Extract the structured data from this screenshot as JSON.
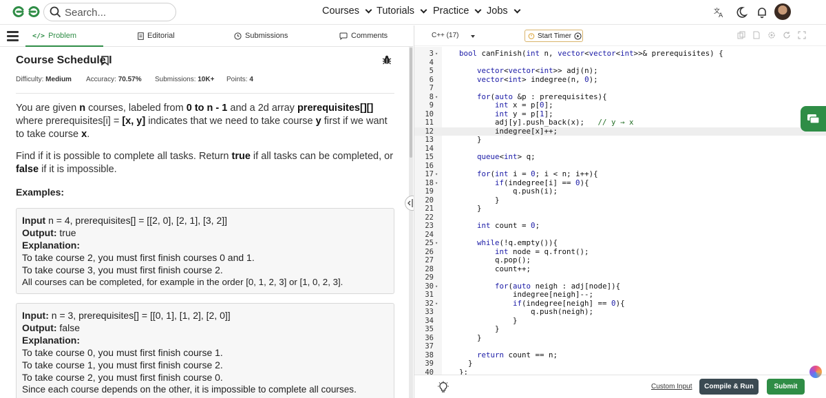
{
  "nav": {
    "search_placeholder": "Search...",
    "menus": [
      "Courses",
      "Tutorials",
      "Practice",
      "Jobs"
    ]
  },
  "tabs": {
    "problem": "Problem",
    "editorial": "Editorial",
    "submissions": "Submissions",
    "comments": "Comments"
  },
  "problem": {
    "title": "Course Schedule I",
    "difficulty_label": "Difficulty:",
    "difficulty": "Medium",
    "accuracy_label": "Accuracy:",
    "accuracy": "70.57%",
    "submissions_label": "Submissions:",
    "submissions": "10K+",
    "points_label": "Points:",
    "points": "4",
    "desc1": {
      "a": "You are given ",
      "n": "n",
      "b": " courses, labeled from ",
      "range": "0 to n - 1",
      "c": " and a 2d array ",
      "arr": "prerequisites[][]",
      "d": " where prerequisites[i] = ",
      "pair": "[x, y]",
      "e": " indicates that we need to take course ",
      "y": "y",
      "f": " first if we want to take course ",
      "x": "x",
      "g": "."
    },
    "desc2": {
      "a": "Find if it is possible to complete all tasks. Return ",
      "t": "true",
      "b": " if all tasks can be completed, or ",
      "f": "false",
      "c": " if it is impossible."
    },
    "examples_heading": "Examples:",
    "example1": {
      "input_label": "Input",
      "input": " n = 4, prerequisites[] = [[2, 0], [2, 1], [3, 2]]",
      "output_label": "Output:",
      "output": " true",
      "expl_label": "Explanation:",
      "lines": [
        "To take course 2, you must first finish courses 0 and 1.",
        "To take course 3, you must first finish course 2.",
        "All courses can be completed, for example in the order [0, 1, 2, 3] or [1, 0, 2, 3]."
      ]
    },
    "example2": {
      "input_label": "Input:",
      "input": " n = 3, prerequisites[] = [[0, 1], [1, 2], [2, 0]]",
      "output_label": "Output:",
      "output": " false",
      "expl_label": "Explanation:",
      "lines": [
        "To take course 0, you must first finish course 1.",
        "To take course 1, you must first finish course 2.",
        "To take course 2, you must first finish course 0.",
        "Since each course depends on the other, it is impossible to complete all courses."
      ]
    }
  },
  "editor": {
    "language": "C++ (17)",
    "timer_label": "Start Timer",
    "custom_input": "Custom Input",
    "compile_run": "Compile & Run",
    "submit": "Submit",
    "lines": [
      {
        "n": "3",
        "fold": true,
        "t": "bool canFinish(int n, vector<vector<int>>& prerequisites) {"
      },
      {
        "n": "4",
        "fold": false,
        "t": ""
      },
      {
        "n": "5",
        "fold": false,
        "t": "    vector<vector<int>> adj(n);"
      },
      {
        "n": "6",
        "fold": false,
        "t": "    vector<int> indegree(n, 0);"
      },
      {
        "n": "7",
        "fold": false,
        "t": ""
      },
      {
        "n": "8",
        "fold": true,
        "t": "    for(auto &p : prerequisites){"
      },
      {
        "n": "9",
        "fold": false,
        "t": "        int x = p[0];"
      },
      {
        "n": "10",
        "fold": false,
        "t": "        int y = p[1];"
      },
      {
        "n": "11",
        "fold": false,
        "t": "        adj[y].push_back(x);   // y → x"
      },
      {
        "n": "12",
        "fold": false,
        "t": "        indegree[x]++;",
        "hl": true
      },
      {
        "n": "13",
        "fold": false,
        "t": "    }"
      },
      {
        "n": "14",
        "fold": false,
        "t": ""
      },
      {
        "n": "15",
        "fold": false,
        "t": "    queue<int> q;"
      },
      {
        "n": "16",
        "fold": false,
        "t": ""
      },
      {
        "n": "17",
        "fold": true,
        "t": "    for(int i = 0; i < n; i++){"
      },
      {
        "n": "18",
        "fold": true,
        "t": "        if(indegree[i] == 0){"
      },
      {
        "n": "19",
        "fold": false,
        "t": "            q.push(i);"
      },
      {
        "n": "20",
        "fold": false,
        "t": "        }"
      },
      {
        "n": "21",
        "fold": false,
        "t": "    }"
      },
      {
        "n": "22",
        "fold": false,
        "t": ""
      },
      {
        "n": "23",
        "fold": false,
        "t": "    int count = 0;"
      },
      {
        "n": "24",
        "fold": false,
        "t": ""
      },
      {
        "n": "25",
        "fold": true,
        "t": "    while(!q.empty()){"
      },
      {
        "n": "26",
        "fold": false,
        "t": "        int node = q.front();"
      },
      {
        "n": "27",
        "fold": false,
        "t": "        q.pop();"
      },
      {
        "n": "28",
        "fold": false,
        "t": "        count++;"
      },
      {
        "n": "29",
        "fold": false,
        "t": ""
      },
      {
        "n": "30",
        "fold": true,
        "t": "        for(auto neigh : adj[node]){"
      },
      {
        "n": "31",
        "fold": false,
        "t": "            indegree[neigh]--;"
      },
      {
        "n": "32",
        "fold": true,
        "t": "            if(indegree[neigh] == 0){"
      },
      {
        "n": "33",
        "fold": false,
        "t": "                q.push(neigh);"
      },
      {
        "n": "34",
        "fold": false,
        "t": "            }"
      },
      {
        "n": "35",
        "fold": false,
        "t": "        }"
      },
      {
        "n": "36",
        "fold": false,
        "t": "    }"
      },
      {
        "n": "37",
        "fold": false,
        "t": ""
      },
      {
        "n": "38",
        "fold": false,
        "t": "    return count == n;"
      },
      {
        "n": "39",
        "fold": false,
        "t": "  }"
      },
      {
        "n": "40",
        "fold": false,
        "t": "};"
      }
    ]
  },
  "colors": {
    "brand_green": "#2f8d46",
    "compile_bg": "#3b4a52"
  }
}
